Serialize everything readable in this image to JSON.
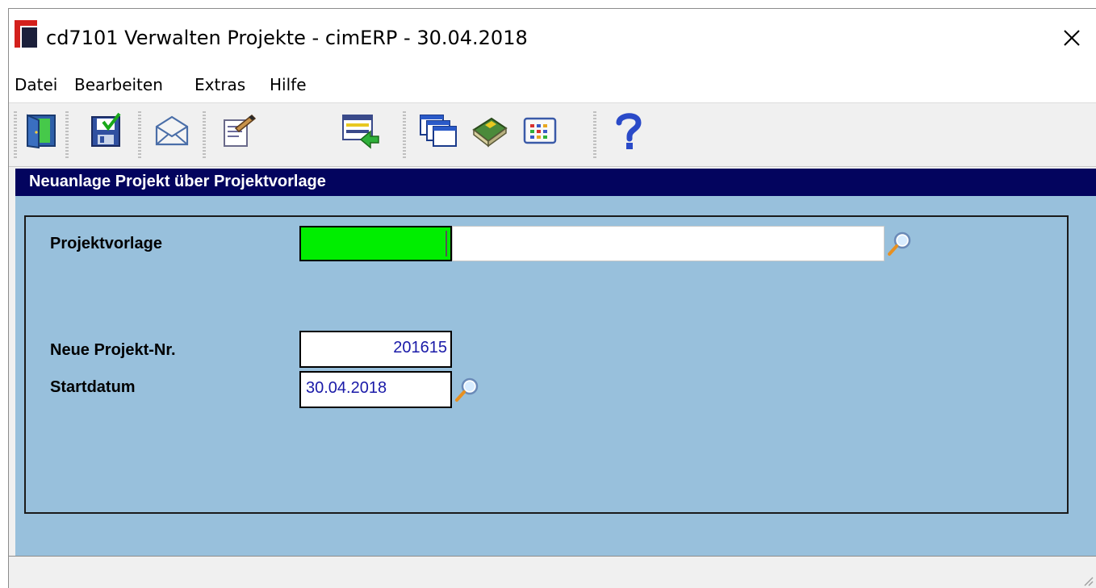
{
  "window": {
    "title": "cd7101 Verwalten Projekte - cimERP - 30.04.2018"
  },
  "menu": {
    "items": [
      "Datei",
      "Bearbeiten",
      "Extras",
      "Hilfe"
    ]
  },
  "toolbar": {
    "icons": [
      "exit-door-icon",
      "save-icon",
      "mail-icon",
      "edit-notes-icon",
      "transfer-list-icon",
      "windows-icon",
      "book-icon",
      "calendar-grid-icon",
      "help-icon"
    ]
  },
  "panel": {
    "title": "Neuanlage Projekt über Projektvorlage"
  },
  "form": {
    "projektvorlage_label": "Projektvorlage",
    "projektvorlage_value": "",
    "projektvorlage_desc": "",
    "neue_projekt_nr_label": "Neue Projekt-Nr.",
    "neue_projekt_nr_value": "201615",
    "startdatum_label": "Startdatum",
    "startdatum_value": "30.04.2018"
  },
  "colors": {
    "panel_header": "#03045e",
    "content_bg": "#98c0dc",
    "active_field": "#00ee00",
    "field_text": "#1a1aa8"
  }
}
